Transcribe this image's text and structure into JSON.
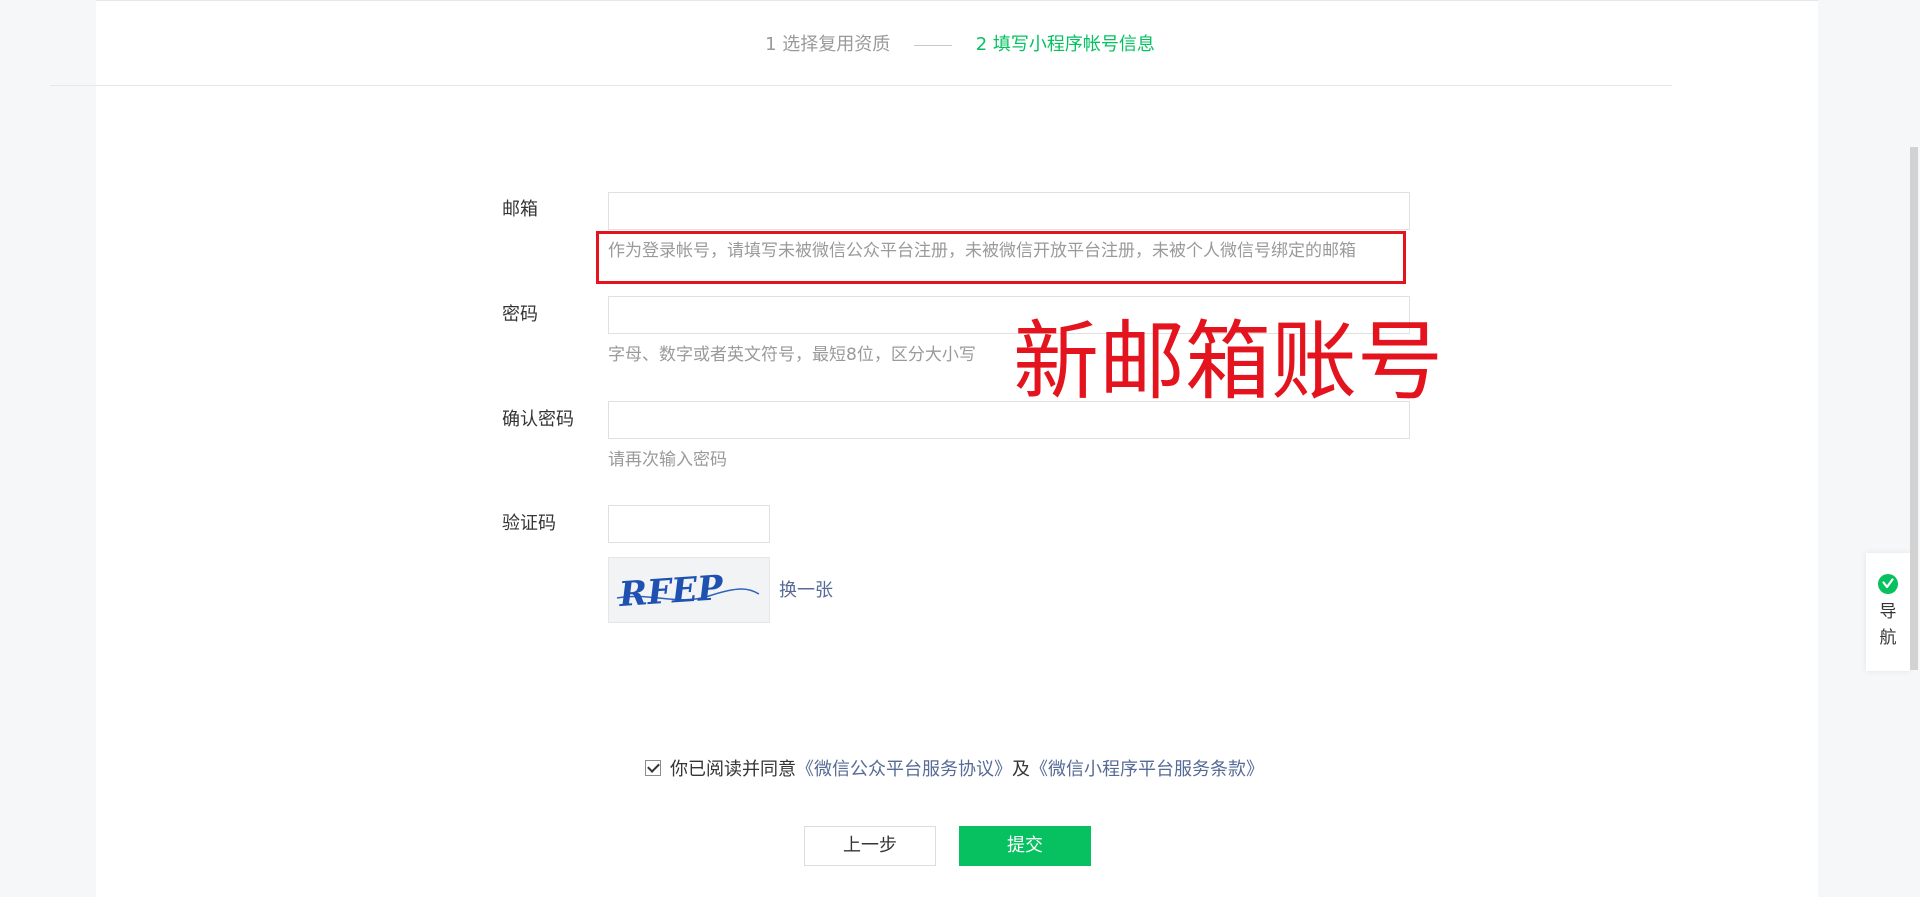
{
  "steps": [
    {
      "label": "1 选择复用资质",
      "state": "done"
    },
    {
      "label": "2 填写小程序帐号信息",
      "state": "active"
    }
  ],
  "form": {
    "email": {
      "label": "邮箱",
      "value": "",
      "hint": "作为登录帐号，请填写未被微信公众平台注册，未被微信开放平台注册，未被个人微信号绑定的邮箱"
    },
    "password": {
      "label": "密码",
      "value": "",
      "hint": "字母、数字或者英文符号，最短8位，区分大小写"
    },
    "confirm": {
      "label": "确认密码",
      "value": "",
      "hint": "请再次输入密码"
    },
    "captcha": {
      "label": "验证码",
      "value": "",
      "image_text": "RFEP",
      "refresh_label": "换一张"
    }
  },
  "annotation": {
    "text": "新邮箱账号",
    "color": "#e3141e"
  },
  "agreement": {
    "checked": true,
    "prefix": "你已阅读并同意",
    "link1": "《微信公众平台服务协议》",
    "middle": "及",
    "link2": "《微信小程序平台服务条款》"
  },
  "buttons": {
    "prev": "上一步",
    "submit": "提交"
  },
  "side_nav": {
    "label_line1": "导",
    "label_line2": "航",
    "icon": "wechat-badge-icon"
  },
  "colors": {
    "accent": "#07c160",
    "link": "#576b95",
    "annotation": "#e3141e"
  }
}
